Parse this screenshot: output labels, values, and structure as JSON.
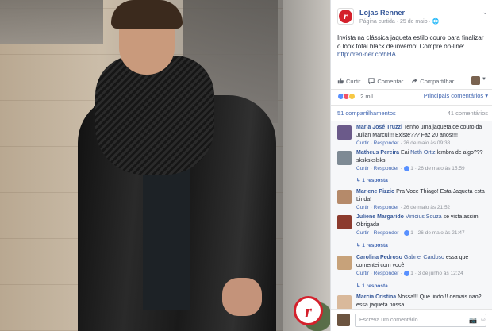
{
  "post": {
    "page_name": "Lojas Renner",
    "meta": "Página curtida · 25 de maio ·",
    "text_main": "Invista na clássica jaqueta estilo couro para finalizar o look total black de inverno! Compre on-line: ",
    "link": "http://ren-ner.co/hHA",
    "brand_letter": "r"
  },
  "actions": {
    "like": "Curtir",
    "comment": "Comentar",
    "share": "Compartilhar"
  },
  "reactions": {
    "count": "2 mil",
    "sort": "Principais comentários ▾"
  },
  "shares": {
    "label": "51 compartilhamentos",
    "comments": "41 comentários"
  },
  "comments": [
    {
      "name": "Maria José Truzzi",
      "text": " Tenho uma jaqueta de couro da Julian Marcul!!! Existe??? Faz 20 anos!!!!",
      "meta_like": "Curtir",
      "meta_reply": "Responder",
      "time": "26 de maio às 09:38"
    },
    {
      "name": "Matheus Pereira",
      "text_before": " Eai ",
      "mention": "Nath Ortiz",
      "text": " lembra de algo???skskskslsks",
      "meta_like": "Curtir",
      "meta_reply": "Responder",
      "likes": "1",
      "time": "26 de maio às 15:59",
      "replies": "1 resposta"
    },
    {
      "name": "Marlene Pizzio",
      "text": " Pra Voce Thiago! Esta Jaqueta esta Linda!",
      "meta_like": "Curtir",
      "meta_reply": "Responder",
      "time": "26 de maio às 21:52"
    },
    {
      "name": "Juliene Margarido",
      "mention": " Vinicius Souza",
      "text": " se vista assim Obrigada",
      "meta_like": "Curtir",
      "meta_reply": "Responder",
      "likes": "1",
      "time": "26 de maio às 21:47",
      "replies": "1 resposta"
    },
    {
      "name": "Carolina Pedroso",
      "mention": " Gabriel Cardoso",
      "text": " essa que comentei com você",
      "meta_like": "Curtir",
      "meta_reply": "Responder",
      "likes": "1",
      "time": "3 de junho às 12:24",
      "replies": "1 resposta"
    },
    {
      "name": "Marcia Cristina",
      "text": " Nossa!!! Que lindo!!! demais nao? essa jaqueta nossa.",
      "meta_like": "",
      "meta_reply": "",
      "time": ""
    }
  ],
  "compose": {
    "placeholder": "Escreva um comentário..."
  },
  "colors": {
    "brand_red": "#d4202b",
    "fb_blue": "#365899",
    "link_blue": "#4267b2",
    "meta_gray": "#90949c"
  }
}
